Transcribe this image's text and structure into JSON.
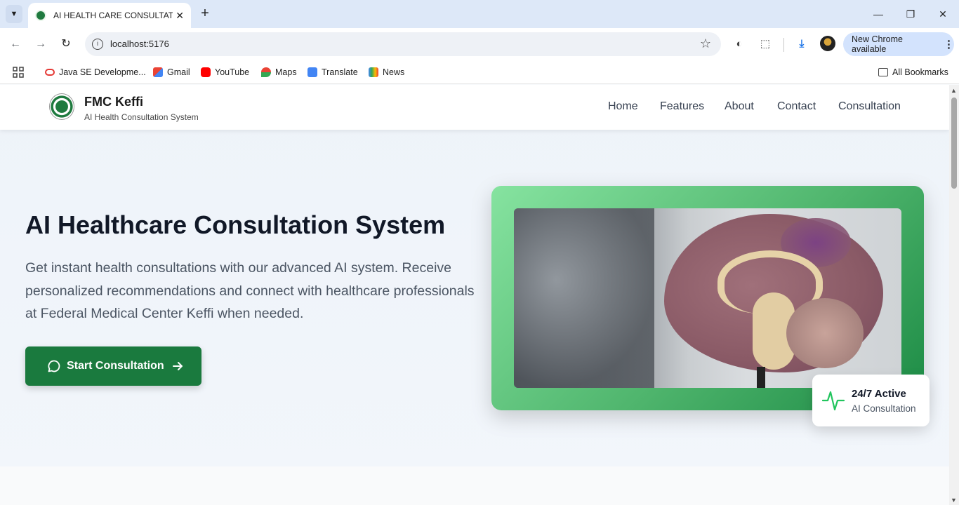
{
  "browser": {
    "tab_title": "AI HEALTH CARE CONSULTATION",
    "url": "localhost:5176",
    "update_label": "New Chrome available",
    "bookmarks": [
      "Java SE Developme...",
      "Gmail",
      "YouTube",
      "Maps",
      "Translate",
      "News"
    ],
    "all_bookmarks": "All Bookmarks"
  },
  "site": {
    "brand_name": "FMC Keffi",
    "brand_sub": "AI Health Consultation System",
    "nav": [
      "Home",
      "Features",
      "About",
      "Contact",
      "Consultation"
    ]
  },
  "hero": {
    "title": "AI Healthcare Consultation System",
    "description": "Get instant health consultations with our advanced AI system. Receive personalized recommendations and connect with healthcare professionals at Federal Medical Center Keffi when needed.",
    "cta_label": "Start Consultation"
  },
  "badge": {
    "title": "24/7 Active",
    "subtitle": "AI Consultation"
  },
  "colors": {
    "primary_green": "#1a7a3e",
    "accent_green": "#22c55e"
  }
}
